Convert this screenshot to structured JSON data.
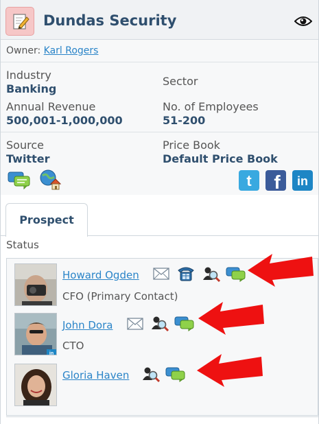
{
  "header": {
    "title": "Dundas Security"
  },
  "owner": {
    "label": "Owner:",
    "name": "Karl Rogers"
  },
  "fields": {
    "industry_label": "Industry",
    "industry_value": "Banking",
    "sector_label": "Sector",
    "revenue_label": "Annual Revenue",
    "revenue_value": "500,001-1,000,000",
    "employees_label": "No. of Employees",
    "employees_value": "51-200",
    "source_label": "Source",
    "source_value": "Twitter",
    "pricebook_label": "Price Book",
    "pricebook_value": "Default Price Book"
  },
  "social": {
    "twitter": "t",
    "facebook": "f",
    "linkedin": "in"
  },
  "tabs": [
    {
      "label": "Prospect"
    }
  ],
  "status_label": "Status",
  "contacts": [
    {
      "name": "Howard Ogden",
      "title": "CFO (Primary Contact)"
    },
    {
      "name": "John Dora",
      "title": "CTO"
    },
    {
      "name": "Gloria Haven",
      "title": ""
    }
  ],
  "colors": {
    "accent": "#2f4f6e",
    "link": "#2a84c8",
    "arrow": "#ee1111"
  }
}
